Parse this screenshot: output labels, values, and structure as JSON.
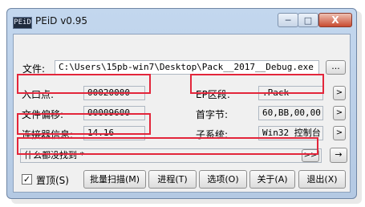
{
  "window": {
    "title": "PEiD v0.95",
    "icon_text": "PEiD",
    "minimize_symbol": "─",
    "maximize_symbol": "□",
    "close_symbol": "X"
  },
  "file": {
    "label": "文件:",
    "path": "C:\\Users\\15pb-win7\\Desktop\\Pack__2017__Debug.exe",
    "browse_label": "..."
  },
  "info": {
    "entry_point_label": "入口点:",
    "entry_point_value": "00020000",
    "ep_section_label": "EP区段:",
    "ep_section_value": ".Pack",
    "file_offset_label": "文件偏移:",
    "file_offset_value": "00009600",
    "first_bytes_label": "首字节:",
    "first_bytes_value": "60,BB,00,00",
    "linker_info_label": "连接器信息:",
    "linker_info_value": "14.16",
    "subsystem_label": "子系统:",
    "subsystem_value": "Win32 控制台"
  },
  "arrow_symbol": ">",
  "result": {
    "text": "什么都没找到  *",
    "expand_label": ">>",
    "action_symbol": "→"
  },
  "bottom": {
    "stay_on_top_label": "置顶(S)",
    "stay_on_top_checked": "✓",
    "batch_scan_label": "批量扫描(M)",
    "process_label": "进程(T)",
    "options_label": "选项(O)",
    "about_label": "关于(A)",
    "exit_label": "退出(X)"
  },
  "colors": {
    "highlight_box": "#e3263b",
    "title_bar": "#c3d7ee",
    "close_button": "#c84a30"
  }
}
